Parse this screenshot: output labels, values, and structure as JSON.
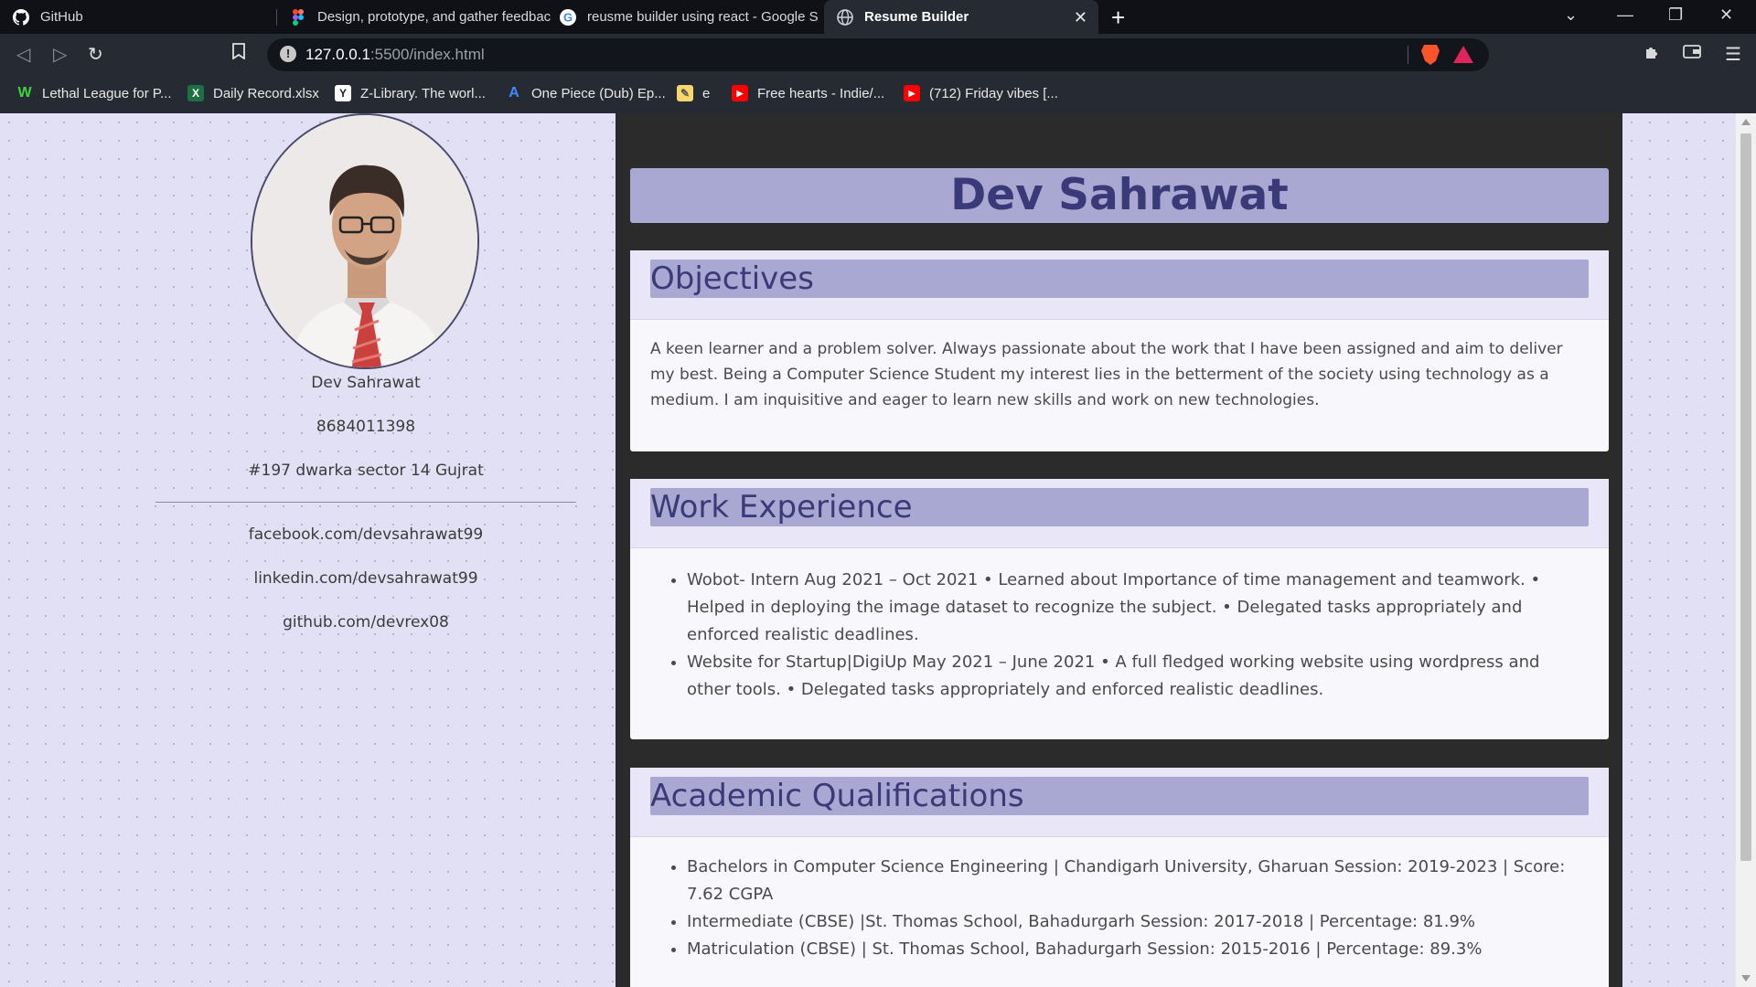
{
  "browser": {
    "tabs": [
      {
        "title": "GitHub"
      },
      {
        "title": "Design, prototype, and gather feedbac"
      },
      {
        "title": "reusme builder using react - Google S"
      },
      {
        "title": "Resume Builder"
      }
    ],
    "url": {
      "host": "127.0.0.1",
      "path": ":5500/index.html"
    },
    "bookmarks": [
      {
        "label": "Lethal League for P..."
      },
      {
        "label": "Daily Record.xlsx"
      },
      {
        "label": "Z-Library. The worl..."
      },
      {
        "label": "One Piece (Dub) Ep..."
      },
      {
        "label": "e"
      },
      {
        "label": "Free hearts - Indie/..."
      },
      {
        "label": "(712) Friday vibes [..."
      }
    ]
  },
  "profile": {
    "name": "Dev Sahrawat",
    "phone": "8684011398",
    "address": "#197 dwarka sector 14 Gujrat",
    "facebook": "facebook.com/devsahrawat99",
    "linkedin": "linkedin.com/devsahrawat99",
    "github": "github.com/devrex08"
  },
  "resume": {
    "name": "Dev Sahrawat",
    "objectives": {
      "title": "Objectives",
      "text": "A keen learner and a problem solver. Always passionate about the work that I have been assigned and aim to deliver my best. Being a Computer Science Student my interest lies in the betterment of the society using technology as a medium. I am inquisitive and eager to learn new skills and work on new technologies."
    },
    "work": {
      "title": "Work Experience",
      "items": [
        "Wobot- Intern Aug 2021 – Oct 2021 • Learned about Importance of time management and teamwork. • Helped in deploying the image dataset to recognize the subject. • Delegated tasks appropriately and enforced realistic deadlines.",
        "Website for Startup|DigiUp May 2021 – June 2021 • A full fledged working website using wordpress and other tools. • Delegated tasks appropriately and enforced realistic deadlines."
      ]
    },
    "academic": {
      "title": "Academic Qualifications",
      "items": [
        "Bachelors in Computer Science Engineering | Chandigarh University, Gharuan Session: 2019-2023 | Score: 7.62 CGPA",
        "Intermediate (CBSE) |St. Thomas School, Bahadurgarh Session: 2017-2018 | Percentage: 81.9%",
        "Matriculation (CBSE) | St. Thomas School, Bahadurgarh Session: 2015-2016 | Percentage: 89.3%"
      ]
    }
  }
}
